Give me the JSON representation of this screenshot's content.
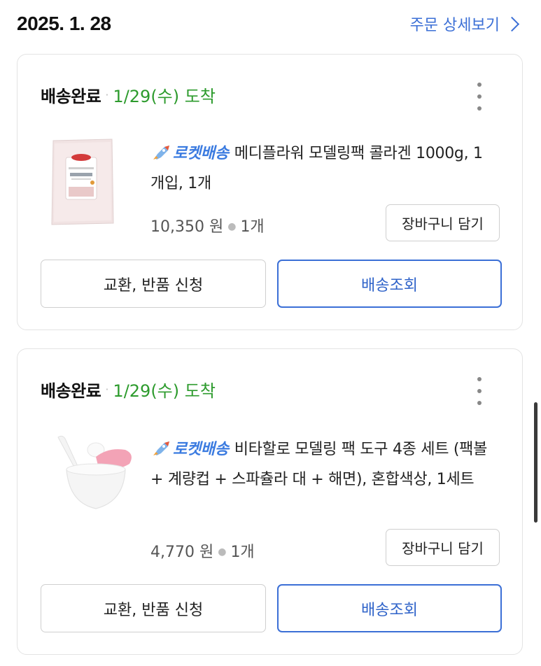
{
  "header": {
    "order_date": "2025. 1. 28",
    "detail_link": "주문 상세보기"
  },
  "orders": [
    {
      "status": "배송완료",
      "arrival": "1/29(수) 도착",
      "delivery_badge": "로켓배송",
      "product_title": "메디플라워 모델링팩 콜라겐 1000g, 1개입, 1개",
      "price": "10,350 원",
      "quantity": "1개",
      "cart_button": "장바구니 담기",
      "return_button": "교환, 반품 신청",
      "track_button": "배송조회",
      "image": "collagen-pack-product-image"
    },
    {
      "status": "배송완료",
      "arrival": "1/29(수) 도착",
      "delivery_badge": "로켓배송",
      "product_title": "비타할로 모델링 팩 도구 4종 세트 (팩볼 + 계량컵 + 스파츌라 대 + 해면), 혼합색상, 1세트",
      "price": "4,770 원",
      "quantity": "1개",
      "cart_button": "장바구니 담기",
      "return_button": "교환, 반품 신청",
      "track_button": "배송조회",
      "image": "mask-tool-set-product-image"
    }
  ],
  "colors": {
    "accent_blue": "#3b6fd6",
    "arrival_green": "#2d9b2d",
    "rocket_blue": "#3b7be0"
  },
  "icons": {
    "rocket": "rocket-icon",
    "more": "more-vertical-icon",
    "chevron": "chevron-right-icon"
  }
}
